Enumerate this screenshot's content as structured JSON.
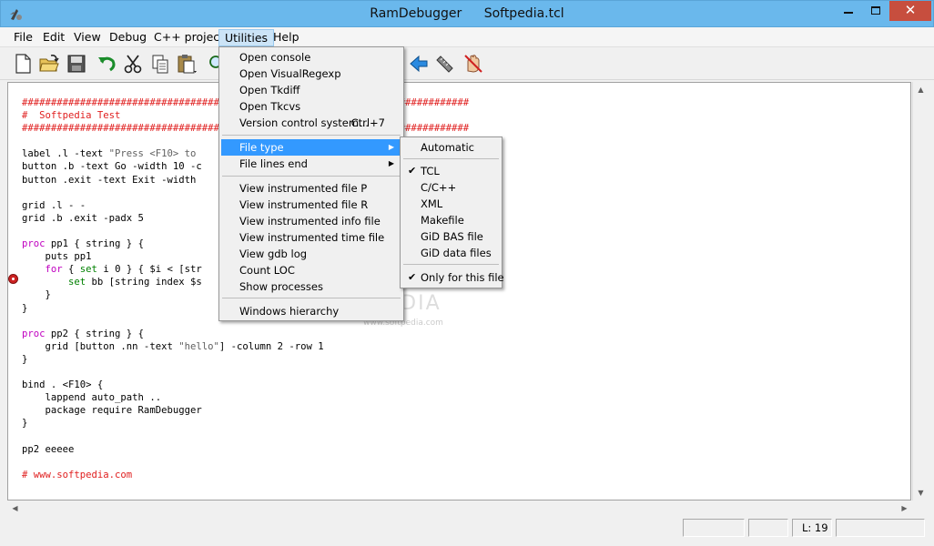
{
  "window": {
    "app_name": "RamDebugger",
    "file_name": "Softpedia.tcl",
    "close_glyph": "✕"
  },
  "menubar": {
    "items": [
      "File",
      "Edit",
      "View",
      "Debug",
      "C++ project",
      "Utilities",
      "Help"
    ],
    "active": "Utilities"
  },
  "toolbar": {
    "icons": [
      "new-file-icon",
      "open-folder-icon",
      "save-icon",
      "undo-icon",
      "cut-icon",
      "copy-icon",
      "paste-icon",
      "search-icon",
      "back-arrow-icon",
      "ruler-icon",
      "clear-breakpoints-icon"
    ]
  },
  "utilities_menu": {
    "items": [
      {
        "label": "Open console"
      },
      {
        "label": "Open VisualRegexp"
      },
      {
        "label": "Open Tkdiff"
      },
      {
        "label": "Open Tkcvs"
      },
      {
        "label": "Version control system...",
        "shortcut": "Ctrl+7"
      },
      {
        "label": "File type"
      },
      {
        "label": "File lines end"
      },
      {
        "label": "View instrumented file P"
      },
      {
        "label": "View instrumented file R"
      },
      {
        "label": "View instrumented info file"
      },
      {
        "label": "View instrumented time file"
      },
      {
        "label": "View gdb log"
      },
      {
        "label": "Count LOC"
      },
      {
        "label": "Show processes"
      },
      {
        "label": "Windows hierarchy"
      }
    ]
  },
  "file_type_menu": {
    "items": [
      {
        "label": "Automatic",
        "checked": false
      },
      {
        "label": "TCL",
        "checked": true
      },
      {
        "label": "C/C++",
        "checked": false
      },
      {
        "label": "XML",
        "checked": false
      },
      {
        "label": "Makefile",
        "checked": false
      },
      {
        "label": "GiD BAS file",
        "checked": false
      },
      {
        "label": "GiD data files",
        "checked": false
      },
      {
        "label": "Only for this file",
        "checked": true
      }
    ],
    "check_glyph": "✔",
    "arrow_glyph": "▶"
  },
  "code": {
    "lines": {
      "l1": "#############################################################################",
      "l2": "#  Softpedia Test",
      "l3": "#############################################################################",
      "l5a": "label .l -text ",
      "l5b": "\"Press <F10> to",
      "l6": "button .b -text Go -width 10 -c",
      "l7": "button .exit -text Exit -width",
      "l9": "grid .l - -",
      "l10": "grid .b .exit -padx 5",
      "l12a": "proc",
      "l12b": " pp1 { string } {",
      "l13": "    puts pp1",
      "l14a": "    ",
      "l14b": "for",
      "l14c": " { ",
      "l14d": "set",
      "l14e": " i 0 } { $i < [str",
      "l15a": "        ",
      "l15b": "set",
      "l15c": " bb [string index $s",
      "l16": "    }",
      "l17": "}",
      "l19a": "proc",
      "l19b": " pp2 { string } {",
      "l20a": "    grid [button .nn -text ",
      "l20b": "\"hello\"",
      "l20c": "] -column 2 -row 1",
      "l21": "}",
      "l23": "bind . <F10> {",
      "l24": "    lappend auto_path ..",
      "l25": "    package require RamDebugger",
      "l26": "}",
      "l28": "pp2 eeeee",
      "l30": "# www.softpedia.com"
    }
  },
  "watermark": {
    "text": "SOFTPEDIA",
    "url": "www.softpedia.com"
  },
  "statusbar": {
    "field1": "",
    "field2": "",
    "line_indicator": "L: 19",
    "field4": ""
  }
}
